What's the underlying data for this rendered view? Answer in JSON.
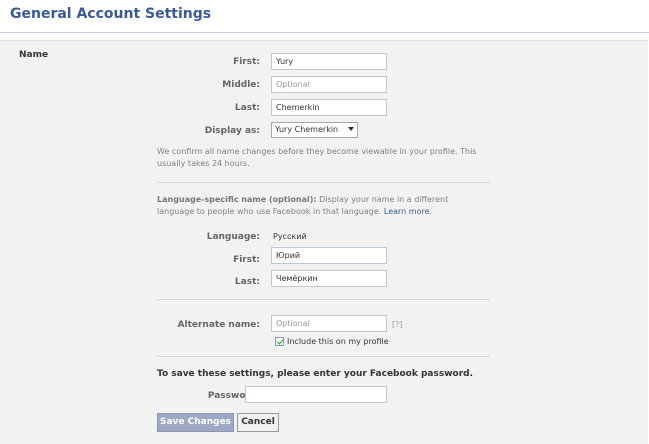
{
  "page": {
    "title": "General Account Settings"
  },
  "name_section": {
    "label": "Name",
    "first": {
      "label": "First:",
      "value": "Yury"
    },
    "middle": {
      "label": "Middle:",
      "placeholder": "Optional"
    },
    "last": {
      "label": "Last:",
      "value": "Chemerkin"
    },
    "display_as": {
      "label": "Display as:",
      "value": "Yury Chemerkin"
    },
    "confirm_note_line1": "We confirm all name changes before they become viewable in your profile. This",
    "confirm_note_line2": "usually takes 24 hours."
  },
  "language_section": {
    "heading": "Language-specific name (optional):",
    "desc_line1": " Display your name in a different",
    "desc_line2": "language to people who use Facebook in that language.",
    "learn_more": "Learn more.",
    "language": {
      "label": "Language:",
      "value": "Русский"
    },
    "first": {
      "label": "First:",
      "value": "Юрий"
    },
    "last": {
      "label": "Last:",
      "value": "Чемёркин"
    }
  },
  "alternate_section": {
    "label": "Alternate name:",
    "placeholder": "Optional",
    "help": "[?]",
    "include_checkbox": {
      "label": "Include this on my profile",
      "checked": true
    }
  },
  "password_section": {
    "prompt": "To save these settings, please enter your Facebook password.",
    "label": "Password:",
    "value": ""
  },
  "buttons": {
    "save": "Save Changes",
    "cancel": "Cancel"
  },
  "colors": {
    "brand": "#3b5998",
    "panel": "#f2f2f2",
    "muted": "#808080"
  }
}
